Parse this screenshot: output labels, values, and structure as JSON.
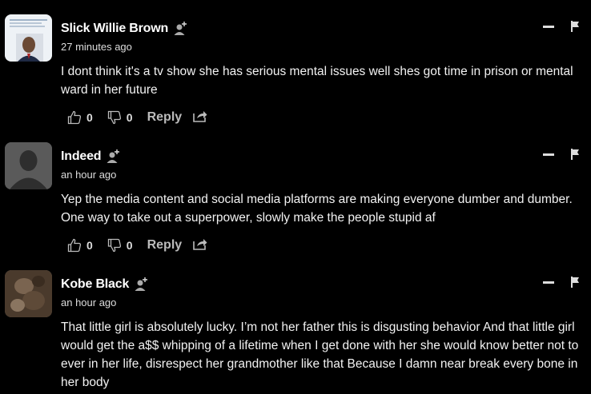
{
  "comments": [
    {
      "author": "Slick Willie Brown",
      "time": "27 minutes ago",
      "text": "I dont think it's a tv show she has serious mental issues well shes got time in prison or mental ward in her future",
      "likes": "0",
      "dislikes": "0",
      "reply_label": "Reply"
    },
    {
      "author": "Indeed",
      "time": "an hour ago",
      "text": "Yep the media content and social media platforms are making everyone dumber and dumber. One way to take out a superpower, slowly make the people stupid af",
      "likes": "0",
      "dislikes": "0",
      "reply_label": "Reply"
    },
    {
      "author": "Kobe Black",
      "time": "an hour ago",
      "text": "That little girl is absolutely lucky. I’m not her father this is disgusting behavior And that little girl would get the a$$ whipping of a lifetime when I get done with her she would know better not to ever in her life, disrespect her grandmother like that Because I damn near break every bone in her body"
    }
  ],
  "icons": {
    "follow": "person-plus-icon",
    "collapse": "minus-icon",
    "report": "flag-icon",
    "like": "thumbs-up-icon",
    "dislike": "thumbs-down-icon",
    "share": "share-icon"
  }
}
